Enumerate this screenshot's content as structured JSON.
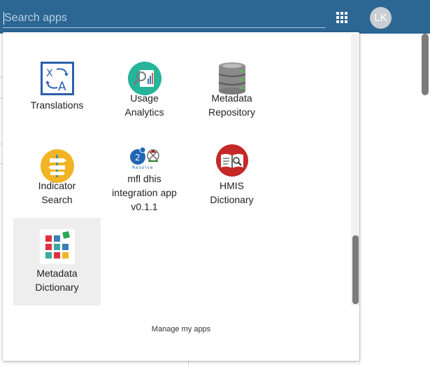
{
  "header": {
    "search": {
      "placeholder": "Search apps",
      "value": ""
    },
    "apps_menu_icon": "apps-grid-icon",
    "user": {
      "initials": "LK"
    },
    "bar_color": "#2c6693"
  },
  "apps_menu": {
    "apps": [
      {
        "label": "Translations",
        "icon": "translation-icon",
        "selected": false
      },
      {
        "label": "Usage\nAnalytics",
        "icon": "analytics-icon",
        "selected": false
      },
      {
        "label": "Metadata\nRepository",
        "icon": "database-icon",
        "selected": false
      },
      {
        "label": "Indicator\nSearch",
        "icon": "signpost-icon",
        "selected": false
      },
      {
        "label": "mfl dhis\nintegration app\nv0.1.1",
        "icon": "resolve-logo-icon",
        "selected": false
      },
      {
        "label": "HMIS\nDictionary",
        "icon": "book-search-icon",
        "selected": false
      },
      {
        "label": "Metadata\nDictionary",
        "icon": "colored-squares-icon",
        "selected": true
      }
    ],
    "manage_label": "Manage my apps"
  }
}
